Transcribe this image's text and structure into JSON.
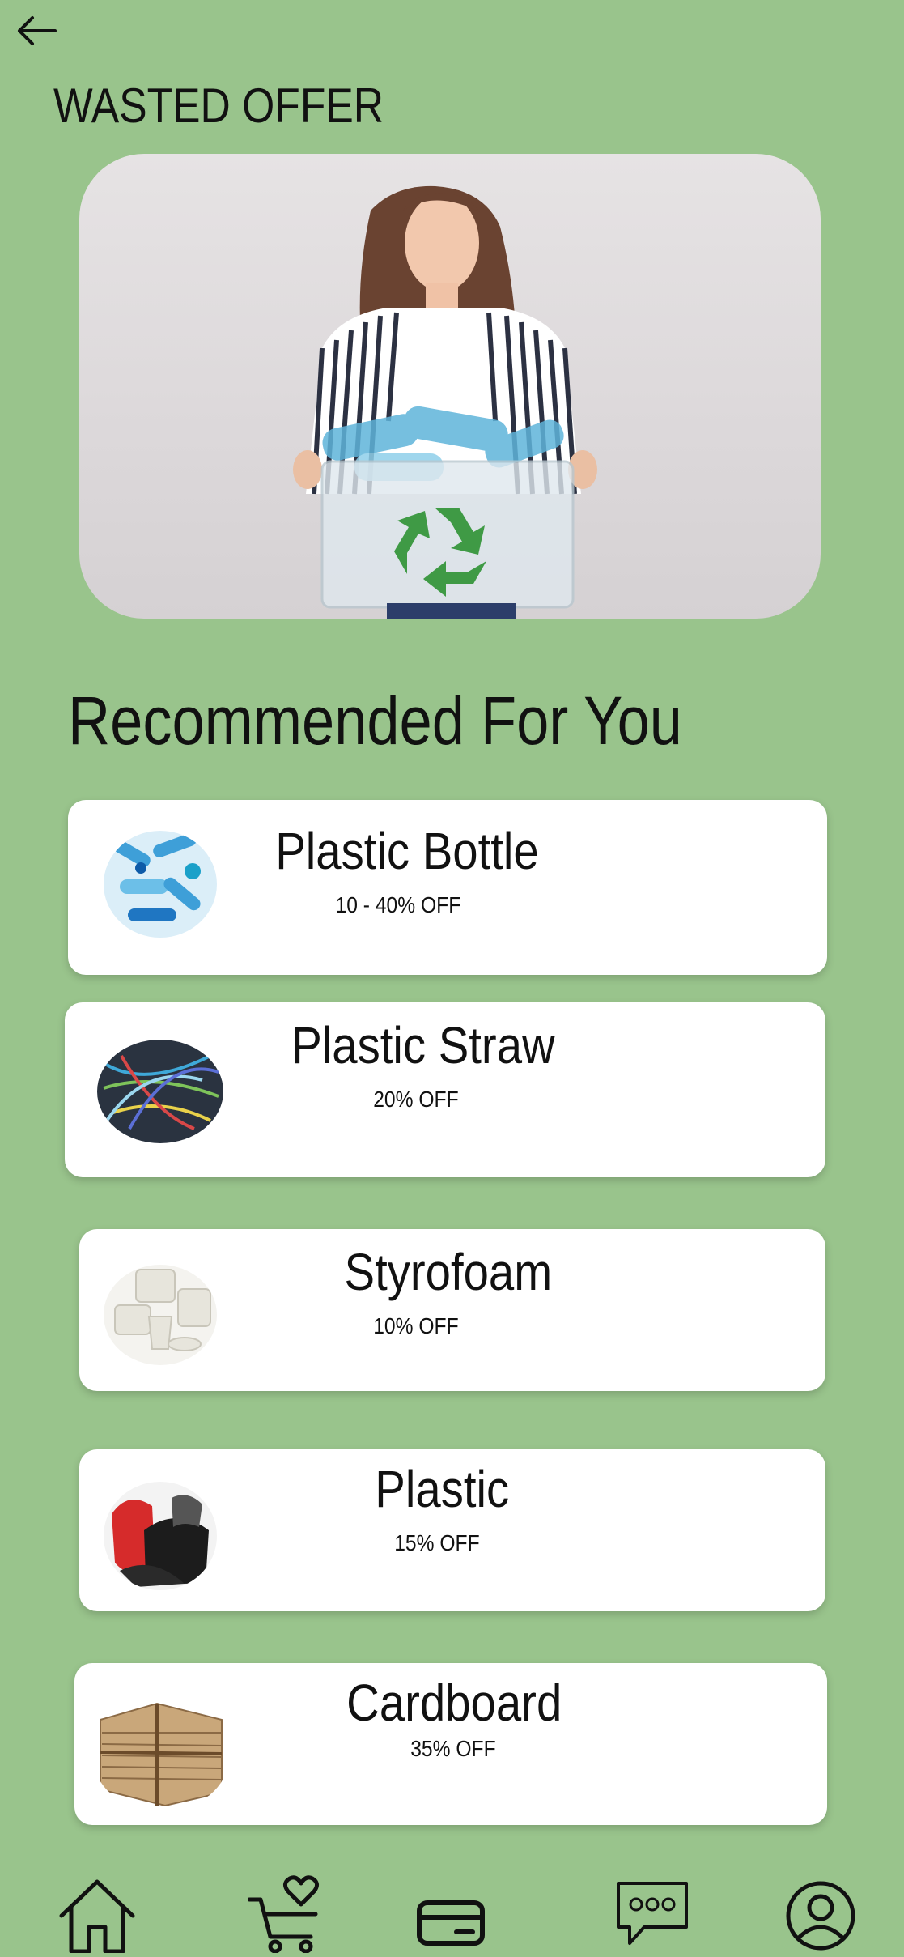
{
  "header": {
    "back_icon": "arrow-left-icon",
    "title": "WASTED OFFER"
  },
  "hero": {
    "image_alt": "Woman holding recycling box of plastic bottles",
    "icon": "recycle-icon"
  },
  "section": {
    "title": "Recommended For You"
  },
  "items": [
    {
      "name": "Plastic Bottle",
      "offer": "10 - 40% OFF",
      "thumbnail": "plastic-bottles"
    },
    {
      "name": "Plastic Straw",
      "offer": "20% OFF",
      "thumbnail": "plastic-straws"
    },
    {
      "name": "Styrofoam",
      "offer": "10% OFF",
      "thumbnail": "styrofoam-containers"
    },
    {
      "name": "Plastic",
      "offer": "15% OFF",
      "thumbnail": "plastic-bags"
    },
    {
      "name": "Cardboard",
      "offer": "35% OFF",
      "thumbnail": "cardboard-stack"
    }
  ],
  "nav": {
    "icons": [
      "home-icon",
      "cart-heart-icon",
      "card-icon",
      "chat-icon",
      "profile-icon"
    ]
  },
  "colors": {
    "background": "#99c48c",
    "card": "#ffffff",
    "accent": "#3f9a45"
  }
}
